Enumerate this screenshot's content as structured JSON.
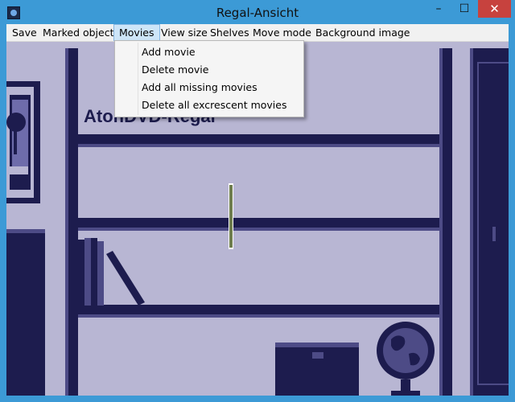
{
  "window": {
    "title": "Regal-Ansicht",
    "controls": {
      "minimize": "–",
      "maximize": "☐",
      "close": "✕"
    }
  },
  "menu": {
    "items": [
      {
        "label": "Save"
      },
      {
        "label": "Marked objects"
      },
      {
        "label": "Movies"
      },
      {
        "label": "View size"
      },
      {
        "label": "Shelves"
      },
      {
        "label": "Move mode"
      },
      {
        "label": "Background image"
      }
    ]
  },
  "movies_menu": {
    "items": [
      {
        "label": "Add movie"
      },
      {
        "label": "Delete movie"
      },
      {
        "label": "Add all missing movies"
      },
      {
        "label": "Delete all excrescent movies"
      }
    ]
  },
  "scene": {
    "shelf_title": "AtonDVD-Regal"
  },
  "colors": {
    "frame": "#3c9ad6",
    "background": "#b8b6d3",
    "shelf": "#1d1c4e",
    "shelf_shadow": "#4d4b86",
    "selection": "#cde5f8"
  }
}
